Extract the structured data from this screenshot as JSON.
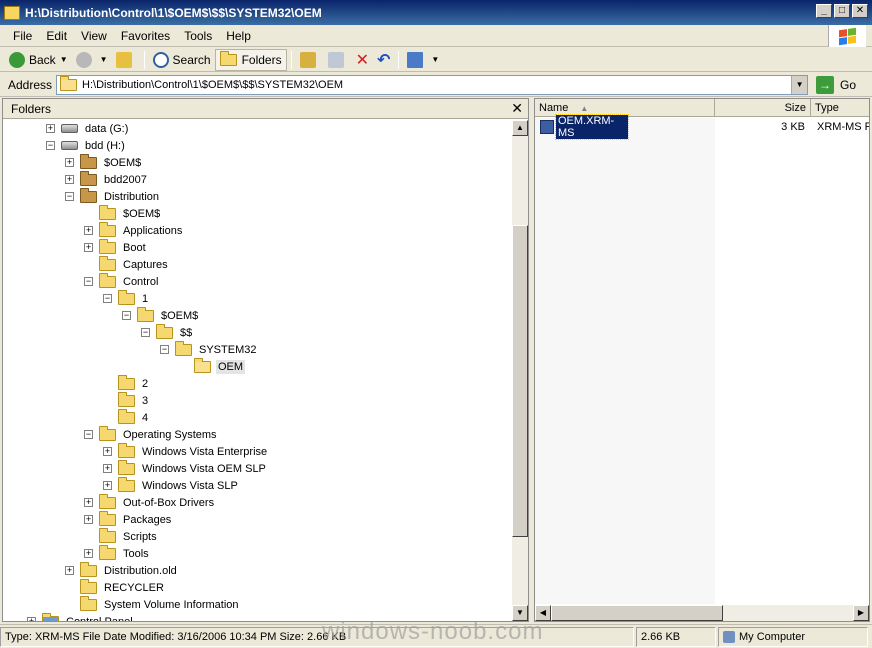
{
  "window": {
    "title": "H:\\Distribution\\Control\\1\\$OEM$\\$$\\SYSTEM32\\OEM"
  },
  "menu": [
    "File",
    "Edit",
    "View",
    "Favorites",
    "Tools",
    "Help"
  ],
  "toolbar": {
    "back": "Back",
    "search": "Search",
    "folders": "Folders"
  },
  "address": {
    "label": "Address",
    "value": "H:\\Distribution\\Control\\1\\$OEM$\\$$\\SYSTEM32\\OEM",
    "go": "Go"
  },
  "folders_pane": {
    "title": "Folders"
  },
  "tree": [
    {
      "label": "data (G:)",
      "icon": "drive-icon",
      "exp": "+"
    },
    {
      "label": "bdd (H:)",
      "icon": "drive-icon",
      "exp": "-"
    },
    {
      "label": "$OEM$",
      "icon": "folder-dark-icon",
      "exp": "+"
    },
    {
      "label": "bdd2007",
      "icon": "folder-dark-icon",
      "exp": "+"
    },
    {
      "label": "Distribution",
      "icon": "folder-dark-icon",
      "exp": "-"
    },
    {
      "label": "$OEM$",
      "icon": "folder-icon",
      "exp": ""
    },
    {
      "label": "Applications",
      "icon": "folder-icon",
      "exp": "+"
    },
    {
      "label": "Boot",
      "icon": "folder-icon",
      "exp": "+"
    },
    {
      "label": "Captures",
      "icon": "folder-icon",
      "exp": ""
    },
    {
      "label": "Control",
      "icon": "folder-icon",
      "exp": "-"
    },
    {
      "label": "1",
      "icon": "folder-icon",
      "exp": "-"
    },
    {
      "label": "$OEM$",
      "icon": "folder-icon",
      "exp": "-"
    },
    {
      "label": "$$",
      "icon": "folder-icon",
      "exp": "-"
    },
    {
      "label": "SYSTEM32",
      "icon": "folder-icon",
      "exp": "-"
    },
    {
      "label": "OEM",
      "icon": "folder-open-icon",
      "exp": "",
      "selected": true
    },
    {
      "label": "2",
      "icon": "folder-icon",
      "exp": ""
    },
    {
      "label": "3",
      "icon": "folder-icon",
      "exp": ""
    },
    {
      "label": "4",
      "icon": "folder-icon",
      "exp": ""
    },
    {
      "label": "Operating Systems",
      "icon": "folder-icon",
      "exp": "-"
    },
    {
      "label": "Windows Vista Enterprise",
      "icon": "folder-icon",
      "exp": "+"
    },
    {
      "label": "Windows Vista OEM SLP",
      "icon": "folder-icon",
      "exp": "+"
    },
    {
      "label": "Windows Vista SLP",
      "icon": "folder-icon",
      "exp": "+"
    },
    {
      "label": "Out-of-Box Drivers",
      "icon": "folder-icon",
      "exp": "+"
    },
    {
      "label": "Packages",
      "icon": "folder-icon",
      "exp": "+"
    },
    {
      "label": "Scripts",
      "icon": "folder-icon",
      "exp": ""
    },
    {
      "label": "Tools",
      "icon": "folder-icon",
      "exp": "+"
    },
    {
      "label": "Distribution.old",
      "icon": "folder-icon",
      "exp": "+"
    },
    {
      "label": "RECYCLER",
      "icon": "folder-icon",
      "exp": ""
    },
    {
      "label": "System Volume Information",
      "icon": "folder-icon",
      "exp": ""
    },
    {
      "label": "Control Panel",
      "icon": "control-panel-icon",
      "exp": "+"
    }
  ],
  "list": {
    "columns": [
      "Name",
      "Size",
      "Type"
    ],
    "files": [
      {
        "name": "OEM.XRM-MS",
        "size": "3 KB",
        "type": "XRM-MS File"
      }
    ]
  },
  "status": {
    "info": "Type: XRM-MS File Date Modified: 3/16/2006 10:34 PM Size: 2.66 KB",
    "size": "2.66 KB",
    "location": "My Computer"
  },
  "watermark": "windows-noob.com"
}
